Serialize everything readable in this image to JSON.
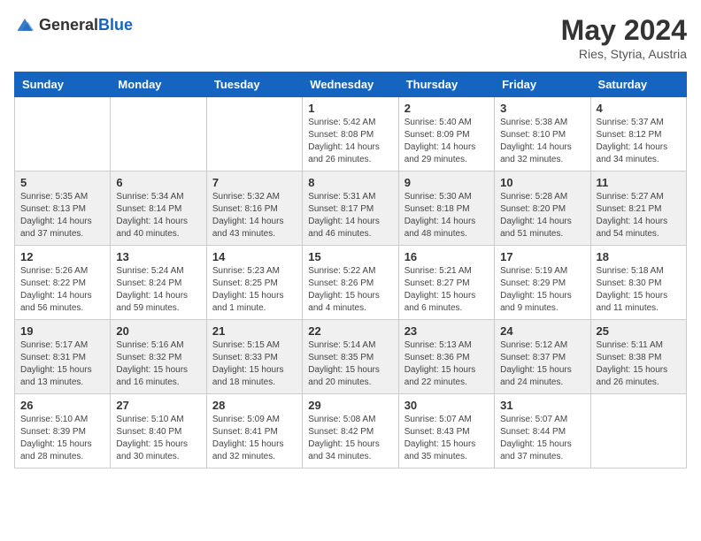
{
  "header": {
    "logo_general": "General",
    "logo_blue": "Blue",
    "title": "May 2024",
    "location": "Ries, Styria, Austria"
  },
  "days_of_week": [
    "Sunday",
    "Monday",
    "Tuesday",
    "Wednesday",
    "Thursday",
    "Friday",
    "Saturday"
  ],
  "weeks": [
    [
      {
        "day": "",
        "sunrise": "",
        "sunset": "",
        "daylight": "",
        "empty": true
      },
      {
        "day": "",
        "sunrise": "",
        "sunset": "",
        "daylight": "",
        "empty": true
      },
      {
        "day": "",
        "sunrise": "",
        "sunset": "",
        "daylight": "",
        "empty": true
      },
      {
        "day": "1",
        "sunrise": "Sunrise: 5:42 AM",
        "sunset": "Sunset: 8:08 PM",
        "daylight": "Daylight: 14 hours and 26 minutes."
      },
      {
        "day": "2",
        "sunrise": "Sunrise: 5:40 AM",
        "sunset": "Sunset: 8:09 PM",
        "daylight": "Daylight: 14 hours and 29 minutes."
      },
      {
        "day": "3",
        "sunrise": "Sunrise: 5:38 AM",
        "sunset": "Sunset: 8:10 PM",
        "daylight": "Daylight: 14 hours and 32 minutes."
      },
      {
        "day": "4",
        "sunrise": "Sunrise: 5:37 AM",
        "sunset": "Sunset: 8:12 PM",
        "daylight": "Daylight: 14 hours and 34 minutes."
      }
    ],
    [
      {
        "day": "5",
        "sunrise": "Sunrise: 5:35 AM",
        "sunset": "Sunset: 8:13 PM",
        "daylight": "Daylight: 14 hours and 37 minutes."
      },
      {
        "day": "6",
        "sunrise": "Sunrise: 5:34 AM",
        "sunset": "Sunset: 8:14 PM",
        "daylight": "Daylight: 14 hours and 40 minutes."
      },
      {
        "day": "7",
        "sunrise": "Sunrise: 5:32 AM",
        "sunset": "Sunset: 8:16 PM",
        "daylight": "Daylight: 14 hours and 43 minutes."
      },
      {
        "day": "8",
        "sunrise": "Sunrise: 5:31 AM",
        "sunset": "Sunset: 8:17 PM",
        "daylight": "Daylight: 14 hours and 46 minutes."
      },
      {
        "day": "9",
        "sunrise": "Sunrise: 5:30 AM",
        "sunset": "Sunset: 8:18 PM",
        "daylight": "Daylight: 14 hours and 48 minutes."
      },
      {
        "day": "10",
        "sunrise": "Sunrise: 5:28 AM",
        "sunset": "Sunset: 8:20 PM",
        "daylight": "Daylight: 14 hours and 51 minutes."
      },
      {
        "day": "11",
        "sunrise": "Sunrise: 5:27 AM",
        "sunset": "Sunset: 8:21 PM",
        "daylight": "Daylight: 14 hours and 54 minutes."
      }
    ],
    [
      {
        "day": "12",
        "sunrise": "Sunrise: 5:26 AM",
        "sunset": "Sunset: 8:22 PM",
        "daylight": "Daylight: 14 hours and 56 minutes."
      },
      {
        "day": "13",
        "sunrise": "Sunrise: 5:24 AM",
        "sunset": "Sunset: 8:24 PM",
        "daylight": "Daylight: 14 hours and 59 minutes."
      },
      {
        "day": "14",
        "sunrise": "Sunrise: 5:23 AM",
        "sunset": "Sunset: 8:25 PM",
        "daylight": "Daylight: 15 hours and 1 minute."
      },
      {
        "day": "15",
        "sunrise": "Sunrise: 5:22 AM",
        "sunset": "Sunset: 8:26 PM",
        "daylight": "Daylight: 15 hours and 4 minutes."
      },
      {
        "day": "16",
        "sunrise": "Sunrise: 5:21 AM",
        "sunset": "Sunset: 8:27 PM",
        "daylight": "Daylight: 15 hours and 6 minutes."
      },
      {
        "day": "17",
        "sunrise": "Sunrise: 5:19 AM",
        "sunset": "Sunset: 8:29 PM",
        "daylight": "Daylight: 15 hours and 9 minutes."
      },
      {
        "day": "18",
        "sunrise": "Sunrise: 5:18 AM",
        "sunset": "Sunset: 8:30 PM",
        "daylight": "Daylight: 15 hours and 11 minutes."
      }
    ],
    [
      {
        "day": "19",
        "sunrise": "Sunrise: 5:17 AM",
        "sunset": "Sunset: 8:31 PM",
        "daylight": "Daylight: 15 hours and 13 minutes."
      },
      {
        "day": "20",
        "sunrise": "Sunrise: 5:16 AM",
        "sunset": "Sunset: 8:32 PM",
        "daylight": "Daylight: 15 hours and 16 minutes."
      },
      {
        "day": "21",
        "sunrise": "Sunrise: 5:15 AM",
        "sunset": "Sunset: 8:33 PM",
        "daylight": "Daylight: 15 hours and 18 minutes."
      },
      {
        "day": "22",
        "sunrise": "Sunrise: 5:14 AM",
        "sunset": "Sunset: 8:35 PM",
        "daylight": "Daylight: 15 hours and 20 minutes."
      },
      {
        "day": "23",
        "sunrise": "Sunrise: 5:13 AM",
        "sunset": "Sunset: 8:36 PM",
        "daylight": "Daylight: 15 hours and 22 minutes."
      },
      {
        "day": "24",
        "sunrise": "Sunrise: 5:12 AM",
        "sunset": "Sunset: 8:37 PM",
        "daylight": "Daylight: 15 hours and 24 minutes."
      },
      {
        "day": "25",
        "sunrise": "Sunrise: 5:11 AM",
        "sunset": "Sunset: 8:38 PM",
        "daylight": "Daylight: 15 hours and 26 minutes."
      }
    ],
    [
      {
        "day": "26",
        "sunrise": "Sunrise: 5:10 AM",
        "sunset": "Sunset: 8:39 PM",
        "daylight": "Daylight: 15 hours and 28 minutes."
      },
      {
        "day": "27",
        "sunrise": "Sunrise: 5:10 AM",
        "sunset": "Sunset: 8:40 PM",
        "daylight": "Daylight: 15 hours and 30 minutes."
      },
      {
        "day": "28",
        "sunrise": "Sunrise: 5:09 AM",
        "sunset": "Sunset: 8:41 PM",
        "daylight": "Daylight: 15 hours and 32 minutes."
      },
      {
        "day": "29",
        "sunrise": "Sunrise: 5:08 AM",
        "sunset": "Sunset: 8:42 PM",
        "daylight": "Daylight: 15 hours and 34 minutes."
      },
      {
        "day": "30",
        "sunrise": "Sunrise: 5:07 AM",
        "sunset": "Sunset: 8:43 PM",
        "daylight": "Daylight: 15 hours and 35 minutes."
      },
      {
        "day": "31",
        "sunrise": "Sunrise: 5:07 AM",
        "sunset": "Sunset: 8:44 PM",
        "daylight": "Daylight: 15 hours and 37 minutes."
      },
      {
        "day": "",
        "sunrise": "",
        "sunset": "",
        "daylight": "",
        "empty": true
      }
    ]
  ]
}
